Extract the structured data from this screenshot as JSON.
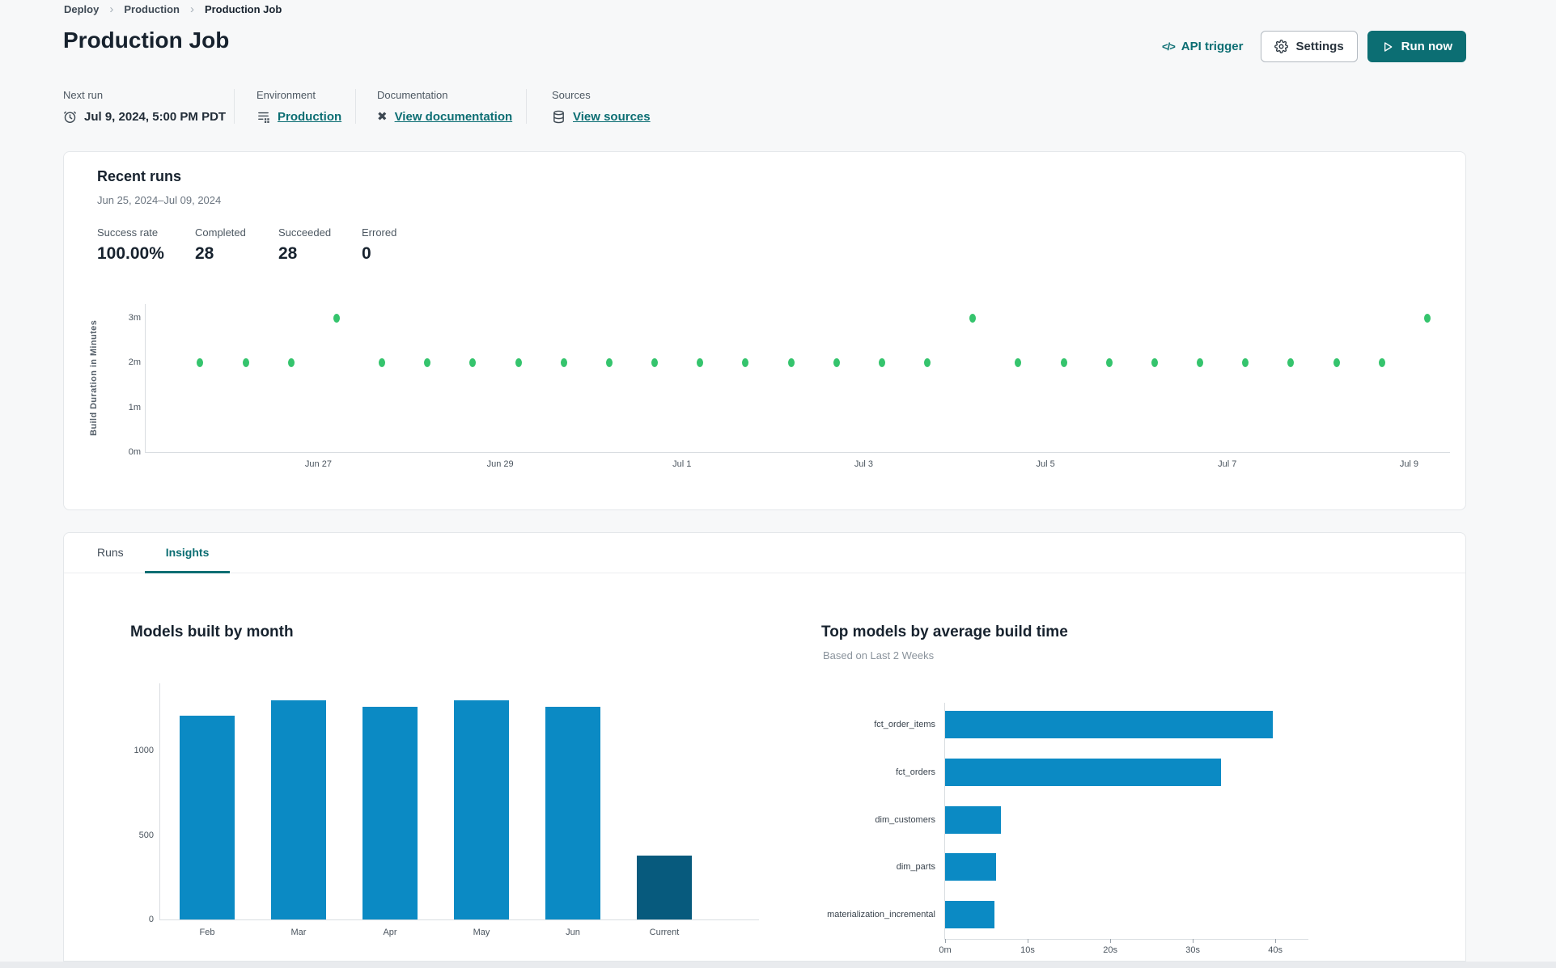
{
  "page": {
    "title": "Production Job"
  },
  "breadcrumb": {
    "separator": "›",
    "items": [
      "Deploy",
      "Production",
      "Production Job"
    ]
  },
  "header": {
    "api_trigger": {
      "label": "API trigger",
      "icon": "</>"
    },
    "settings": {
      "label": "Settings"
    },
    "run_now": {
      "label": "Run now"
    }
  },
  "info_bar": {
    "next_run": {
      "label": "Next run",
      "value": "Jul 9, 2024, 5:00 PM PDT"
    },
    "environment": {
      "label": "Environment",
      "link": "Production"
    },
    "documentation": {
      "label": "Documentation",
      "link": "View documentation"
    },
    "sources": {
      "label": "Sources",
      "link": "View sources"
    }
  },
  "recent_runs": {
    "title": "Recent runs",
    "date_range": "Jun 25, 2024–Jul 09, 2024",
    "stats": [
      {
        "label": "Success rate",
        "value": "100.00%"
      },
      {
        "label": "Completed",
        "value": "28"
      },
      {
        "label": "Succeeded",
        "value": "28"
      },
      {
        "label": "Errored",
        "value": "0"
      }
    ]
  },
  "tabs": [
    {
      "label": "Runs",
      "active": false
    },
    {
      "label": "Insights",
      "active": true
    }
  ],
  "colors": {
    "accent_teal": "#0c6e73",
    "run_dot_green": "#35c46d",
    "bar_blue": "#0b8ac4",
    "bar_highlight": "#075a7d"
  },
  "chart_data": [
    {
      "type": "scatter",
      "name": "recent-runs-build-duration",
      "ylabel": "Build Duration in Minutes",
      "ylim": [
        0,
        3.3
      ],
      "yticks": [
        {
          "value": 0,
          "label": "0m"
        },
        {
          "value": 1,
          "label": "1m"
        },
        {
          "value": 2,
          "label": "2m"
        },
        {
          "value": 3,
          "label": "3m"
        }
      ],
      "x_unit": "days since Jun 25, 2024",
      "xlim": [
        0.1,
        14.45
      ],
      "xticks": [
        {
          "day": 2,
          "label": "Jun 27"
        },
        {
          "day": 4,
          "label": "Jun 29"
        },
        {
          "day": 6,
          "label": "Jul 1"
        },
        {
          "day": 8,
          "label": "Jul 3"
        },
        {
          "day": 10,
          "label": "Jul 5"
        },
        {
          "day": 12,
          "label": "Jul 7"
        },
        {
          "day": 14,
          "label": "Jul 9"
        }
      ],
      "points": [
        {
          "day": 0.7,
          "minutes": 2
        },
        {
          "day": 1.2,
          "minutes": 2
        },
        {
          "day": 1.7,
          "minutes": 2
        },
        {
          "day": 2.2,
          "minutes": 3
        },
        {
          "day": 2.7,
          "minutes": 2
        },
        {
          "day": 3.2,
          "minutes": 2
        },
        {
          "day": 3.7,
          "minutes": 2
        },
        {
          "day": 4.2,
          "minutes": 2
        },
        {
          "day": 4.7,
          "minutes": 2
        },
        {
          "day": 5.2,
          "minutes": 2
        },
        {
          "day": 5.7,
          "minutes": 2
        },
        {
          "day": 6.2,
          "minutes": 2
        },
        {
          "day": 6.7,
          "minutes": 2
        },
        {
          "day": 7.2,
          "minutes": 2
        },
        {
          "day": 7.7,
          "minutes": 2
        },
        {
          "day": 8.2,
          "minutes": 2
        },
        {
          "day": 8.7,
          "minutes": 2
        },
        {
          "day": 9.2,
          "minutes": 3
        },
        {
          "day": 9.7,
          "minutes": 2
        },
        {
          "day": 10.2,
          "minutes": 2
        },
        {
          "day": 10.7,
          "minutes": 2
        },
        {
          "day": 11.2,
          "minutes": 2
        },
        {
          "day": 11.7,
          "minutes": 2
        },
        {
          "day": 12.2,
          "minutes": 2
        },
        {
          "day": 12.7,
          "minutes": 2
        },
        {
          "day": 13.2,
          "minutes": 2
        },
        {
          "day": 13.7,
          "minutes": 2
        },
        {
          "day": 14.2,
          "minutes": 3
        }
      ]
    },
    {
      "type": "bar",
      "title": "Models built by month",
      "categories": [
        "Feb",
        "Mar",
        "Apr",
        "May",
        "Jun",
        "Current"
      ],
      "values": [
        1210,
        1300,
        1260,
        1300,
        1260,
        380
      ],
      "yticks": [
        0,
        500,
        1000
      ],
      "ylim": [
        0,
        1400
      ],
      "highlight_index": 5
    },
    {
      "type": "horizontal_bar",
      "title": "Top models by average build time",
      "subtitle": "Based on Last 2 Weeks",
      "categories": [
        "fct_order_items",
        "fct_orders",
        "dim_customers",
        "dim_parts",
        "materialization_incremental"
      ],
      "values_seconds": [
        39.7,
        33.4,
        6.8,
        6.2,
        6.0
      ],
      "xticks": [
        {
          "value": 0,
          "label": "0m"
        },
        {
          "value": 10,
          "label": "10s"
        },
        {
          "value": 20,
          "label": "20s"
        },
        {
          "value": 30,
          "label": "30s"
        },
        {
          "value": 40,
          "label": "40s"
        }
      ],
      "xlim": [
        0,
        44
      ]
    }
  ]
}
